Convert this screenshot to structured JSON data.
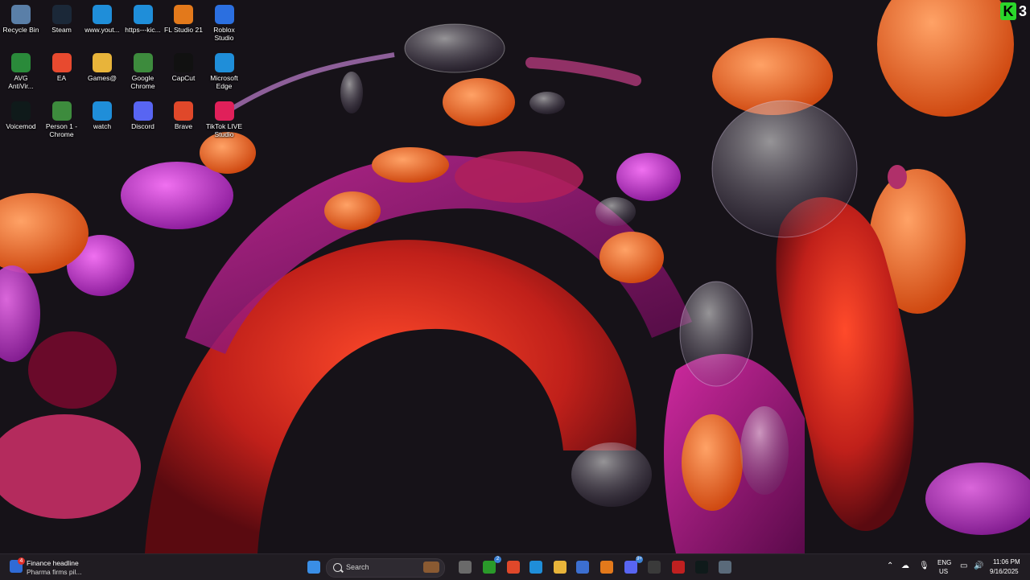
{
  "desktop": {
    "icons": [
      {
        "label": "Recycle Bin",
        "icon": "recycle-bin-icon",
        "color": "#5a7fa8"
      },
      {
        "label": "Steam",
        "icon": "steam-icon",
        "color": "#1b2838"
      },
      {
        "label": "www.yout...",
        "icon": "edge-icon",
        "color": "#1f8ed9"
      },
      {
        "label": "https---kic...",
        "icon": "edge-icon",
        "color": "#1f8ed9"
      },
      {
        "label": "FL Studio 21",
        "icon": "fl-studio-icon",
        "color": "#e3791b"
      },
      {
        "label": "Roblox Studio",
        "icon": "roblox-studio-icon",
        "color": "#2b6fe0"
      },
      {
        "label": "AVG AntiVir...",
        "icon": "avg-icon",
        "color": "#2a8a3a"
      },
      {
        "label": "EA",
        "icon": "ea-icon",
        "color": "#e84a2f"
      },
      {
        "label": "Games@",
        "icon": "games-folder-icon",
        "color": "#e8b43a"
      },
      {
        "label": "Google Chrome",
        "icon": "chrome-icon",
        "color": "#3d8b3d"
      },
      {
        "label": "CapCut",
        "icon": "capcut-icon",
        "color": "#111111"
      },
      {
        "label": "Microsoft Edge",
        "icon": "edge-icon",
        "color": "#1f8ed9"
      },
      {
        "label": "Voicemod",
        "icon": "voicemod-icon",
        "color": "#0f1a1a"
      },
      {
        "label": "Person 1 - Chrome",
        "icon": "chrome-profile-icon",
        "color": "#3d8b3d"
      },
      {
        "label": "watch",
        "icon": "edge-icon",
        "color": "#1f8ed9"
      },
      {
        "label": "Discord",
        "icon": "discord-icon",
        "color": "#5865f2"
      },
      {
        "label": "Brave",
        "icon": "brave-icon",
        "color": "#e0482a"
      },
      {
        "label": "TikTok LIVE Studio",
        "icon": "tiktok-icon",
        "color": "#e0205a"
      }
    ]
  },
  "overlay": {
    "letter": "K",
    "count": "3"
  },
  "taskbar": {
    "widget": {
      "badge": "4",
      "headline": "Finance headline",
      "subtitle": "Pharma firms pil..."
    },
    "search": {
      "placeholder": "Search"
    },
    "apps": [
      {
        "name": "start-button",
        "icon": "windows-icon",
        "color": "#3a8ee6",
        "badge": ""
      },
      {
        "name": "task-view-button",
        "icon": "task-view-icon",
        "color": "#6a6a6a",
        "badge": ""
      },
      {
        "name": "xbox-app",
        "icon": "xbox-icon",
        "color": "#2a9a2a",
        "badge": "2"
      },
      {
        "name": "brave-app",
        "icon": "brave-icon",
        "color": "#e0482a",
        "badge": ""
      },
      {
        "name": "edge-app",
        "icon": "edge-icon",
        "color": "#1f8ed9",
        "badge": ""
      },
      {
        "name": "file-explorer-app",
        "icon": "folder-icon",
        "color": "#e8b43a",
        "badge": ""
      },
      {
        "name": "store-app",
        "icon": "store-icon",
        "color": "#3c6fd0",
        "badge": ""
      },
      {
        "name": "fl-studio-app",
        "icon": "fl-studio-icon",
        "color": "#e3791b",
        "badge": ""
      },
      {
        "name": "discord-app",
        "icon": "discord-icon",
        "color": "#5865f2",
        "badge": "9+"
      },
      {
        "name": "obs-app",
        "icon": "obs-icon",
        "color": "#3a3a3a",
        "badge": ""
      },
      {
        "name": "voicemeeter-app",
        "icon": "voicemeeter-icon",
        "color": "#c02020",
        "badge": ""
      },
      {
        "name": "voicemod-app",
        "icon": "voicemod-icon",
        "color": "#0f1a1a",
        "badge": ""
      },
      {
        "name": "settings-app",
        "icon": "gear-icon",
        "color": "#5a6a7a",
        "badge": ""
      }
    ],
    "tray": {
      "lang": "ENG",
      "region": "US",
      "time": "11:06 PM",
      "date": "9/16/2025"
    }
  }
}
